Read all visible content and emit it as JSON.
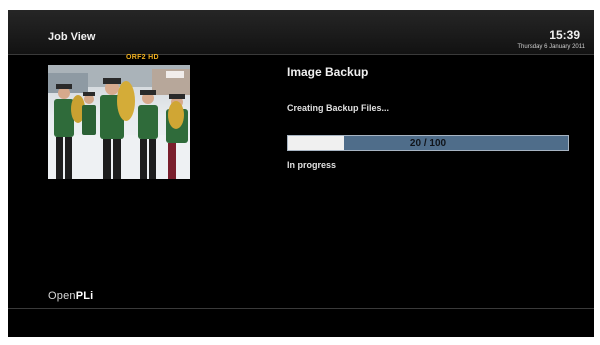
{
  "header": {
    "title": "Job View",
    "time": "15:39",
    "date": "Thursday 6 January 2011"
  },
  "preview": {
    "channel": "ORF2 HD"
  },
  "job": {
    "title": "Image Backup",
    "status": "Creating Backup Files...",
    "progress_text": "20 / 100",
    "progress_fraction": 0.2,
    "state": "In progress"
  },
  "footer": {
    "logo_main": "Open",
    "logo_bold": "PLi"
  },
  "colors": {
    "background": "#000000",
    "progress_fill": "#4f6d8a",
    "progress_track": "#f0f0f0",
    "channel_label": "#f0b020"
  }
}
